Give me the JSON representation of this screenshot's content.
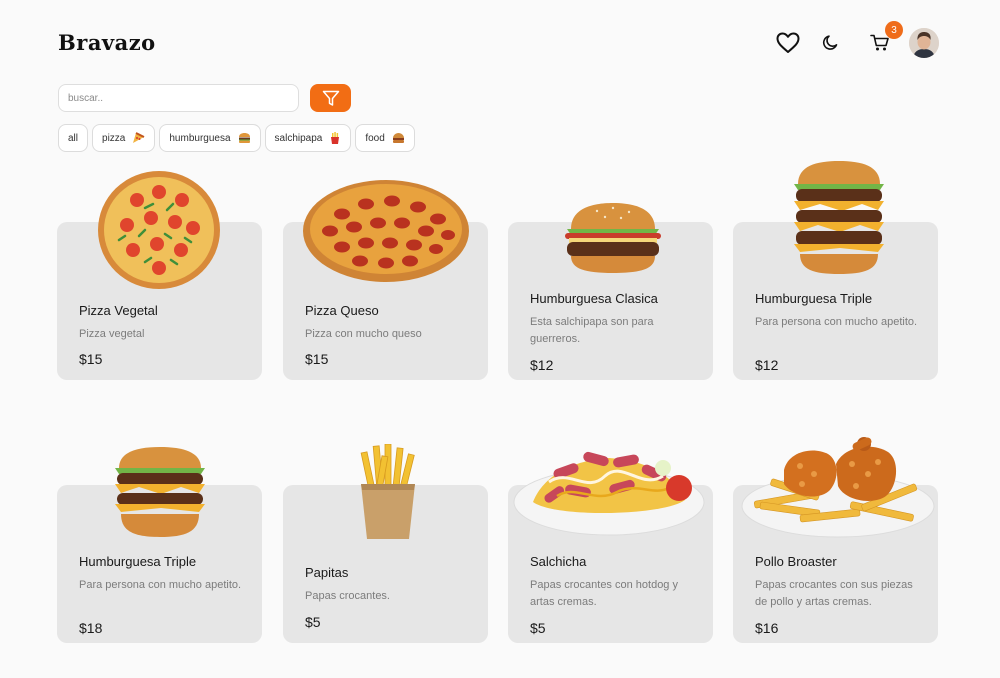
{
  "header": {
    "logo": "Bravazo",
    "cart_count": "3"
  },
  "search": {
    "placeholder": "buscar.."
  },
  "categories": [
    "all",
    "pizza",
    "humburguesa",
    "salchipapa",
    "food"
  ],
  "products": [
    {
      "name": "Pizza Vegetal",
      "description": "Pizza vegetal",
      "price": "$15"
    },
    {
      "name": "Pizza Queso",
      "description": "Pizza con mucho queso",
      "price": "$15"
    },
    {
      "name": "Humburguesa Clasica",
      "description": "Esta salchipapa son para guerreros.",
      "price": "$12"
    },
    {
      "name": "Humburguesa Triple",
      "description": "Para persona con mucho apetito.",
      "price": "$12"
    },
    {
      "name": "Humburguesa Triple",
      "description": "Para persona con mucho apetito.",
      "price": "$18"
    },
    {
      "name": "Papitas",
      "description": "Papas crocantes.",
      "price": "$5"
    },
    {
      "name": "Salchicha",
      "description": "Papas crocantes con hotdog y artas cremas.",
      "price": "$5"
    },
    {
      "name": "Pollo Broaster",
      "description": "Papas crocantes con sus piezas de pollo y artas cremas.",
      "price": "$16"
    }
  ],
  "colors": {
    "accent": "#f26d14",
    "card": "#e6e6e6",
    "background": "#fafafa"
  },
  "icons": [
    "heart-icon",
    "moon-icon",
    "cart-icon",
    "filter-icon"
  ]
}
